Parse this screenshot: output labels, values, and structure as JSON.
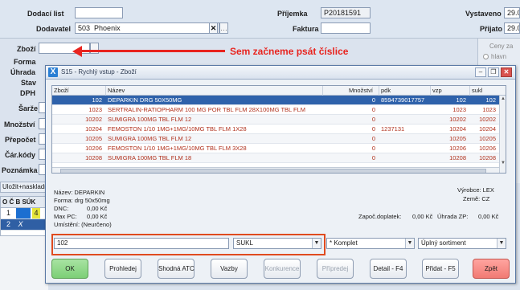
{
  "header": {
    "dodaci_list_label": "Dodací list",
    "dodaci_list_value": "",
    "dodavatel_label": "Dodavatel",
    "dodavatel_code": "503",
    "dodavatel_name": "Phoenix",
    "prijemka_label": "Příjemka",
    "prijemka_value": "P20181591",
    "faktura_label": "Faktura",
    "faktura_value": "",
    "vystaveno_label": "Vystaveno",
    "vystaveno_value": "29.0",
    "prijato_label": "Přijato",
    "prijato_value": "29.0"
  },
  "left_form": {
    "zbozi_label": "Zboží",
    "labels": [
      "Forma",
      "Úhrada",
      "Stav",
      "DPH",
      "Šarže",
      "Množství",
      "Přepočet",
      "Čár.kódy",
      "Poznámka"
    ],
    "ulozit_label": "Uložit+naskladn",
    "grid_header": "O Č B SÚK",
    "rows": [
      {
        "o": "1",
        "c": "",
        "b": "4",
        "selected": false
      },
      {
        "o": "2",
        "c": "X",
        "b": "",
        "selected": true
      }
    ]
  },
  "right_panel": {
    "ceny_label": "Ceny za",
    "hlavni_label": "hlavn"
  },
  "annotation": {
    "text": "Sem začneme psát číslice",
    "color": "#e8241f"
  },
  "dialog": {
    "title": "S15 - Rychlý vstup - Zboží",
    "app_icon": "X",
    "columns": [
      "Zboží",
      "Název",
      "Množství",
      "pdk",
      "vzp",
      "sukl"
    ],
    "rows": [
      {
        "zbozi": "102",
        "nazev": "DEPARKIN DRG 50X50MG",
        "mnozstvi": "0",
        "pdk": "8594739017757",
        "vzp": "102",
        "sukl": "102",
        "selected": true,
        "red": false
      },
      {
        "zbozi": "1023",
        "nazev": "SERTRALIN-RATIOPHARM 100 MG POR TBL FLM 28X100MG TBL FLM",
        "mnozstvi": "0",
        "pdk": "",
        "vzp": "1023",
        "sukl": "1023",
        "selected": false,
        "red": true
      },
      {
        "zbozi": "10202",
        "nazev": "SUMIGRA 100MG TBL FLM 12",
        "mnozstvi": "0",
        "pdk": "",
        "vzp": "10202",
        "sukl": "10202",
        "selected": false,
        "red": true
      },
      {
        "zbozi": "10204",
        "nazev": "FEMOSTON 1/10 1MG+1MG/10MG TBL FLM 1X28",
        "mnozstvi": "0",
        "pdk": "1237131",
        "vzp": "10204",
        "sukl": "10204",
        "selected": false,
        "red": true
      },
      {
        "zbozi": "10205",
        "nazev": "SUMIGRA 100MG TBL FLM 12",
        "mnozstvi": "0",
        "pdk": "",
        "vzp": "10205",
        "sukl": "10205",
        "selected": false,
        "red": true
      },
      {
        "zbozi": "10206",
        "nazev": "FEMOSTON 1/10 1MG+1MG/10MG TBL FLM 3X28",
        "mnozstvi": "0",
        "pdk": "",
        "vzp": "10206",
        "sukl": "10206",
        "selected": false,
        "red": true
      },
      {
        "zbozi": "10208",
        "nazev": "SUMIGRA 100MG TBL FLM 18",
        "mnozstvi": "0",
        "pdk": "",
        "vzp": "10208",
        "sukl": "10208",
        "selected": false,
        "red": true
      }
    ],
    "details": {
      "nazev": "Název:  DEPARKIN",
      "forma": "Forma:  drg 50x50mg",
      "dnc_label": "DNC:",
      "dnc_value": "0,00 Kč",
      "maxpc_label": "Max PC:",
      "maxpc_value": "0,00 Kč",
      "umisteni": "Umístění: (Neurčeno)",
      "vyrobce": "Výrobce: LEX",
      "zeme": "Země:  CZ",
      "zapoc_label": "Započ.doplatek:",
      "zapoc_value": "0,00 Kč",
      "uhrada_label": "Úhrada ZP:",
      "uhrada_value": "0,00 Kč"
    },
    "search_value": "102",
    "search_type": "SUKL",
    "komplet": "* Komplet",
    "sortiment": "Úplný sortiment",
    "buttons": {
      "ok": "OK",
      "prohledej": "Prohledej",
      "shodna_atc": "Shodná ATC",
      "vazby": "Vazby",
      "konkurence": "Konkurence",
      "pripredej": "Přípredej",
      "detail": "Detail - F4",
      "pridat": "Přidat - F5",
      "zpet": "Zpět"
    }
  }
}
